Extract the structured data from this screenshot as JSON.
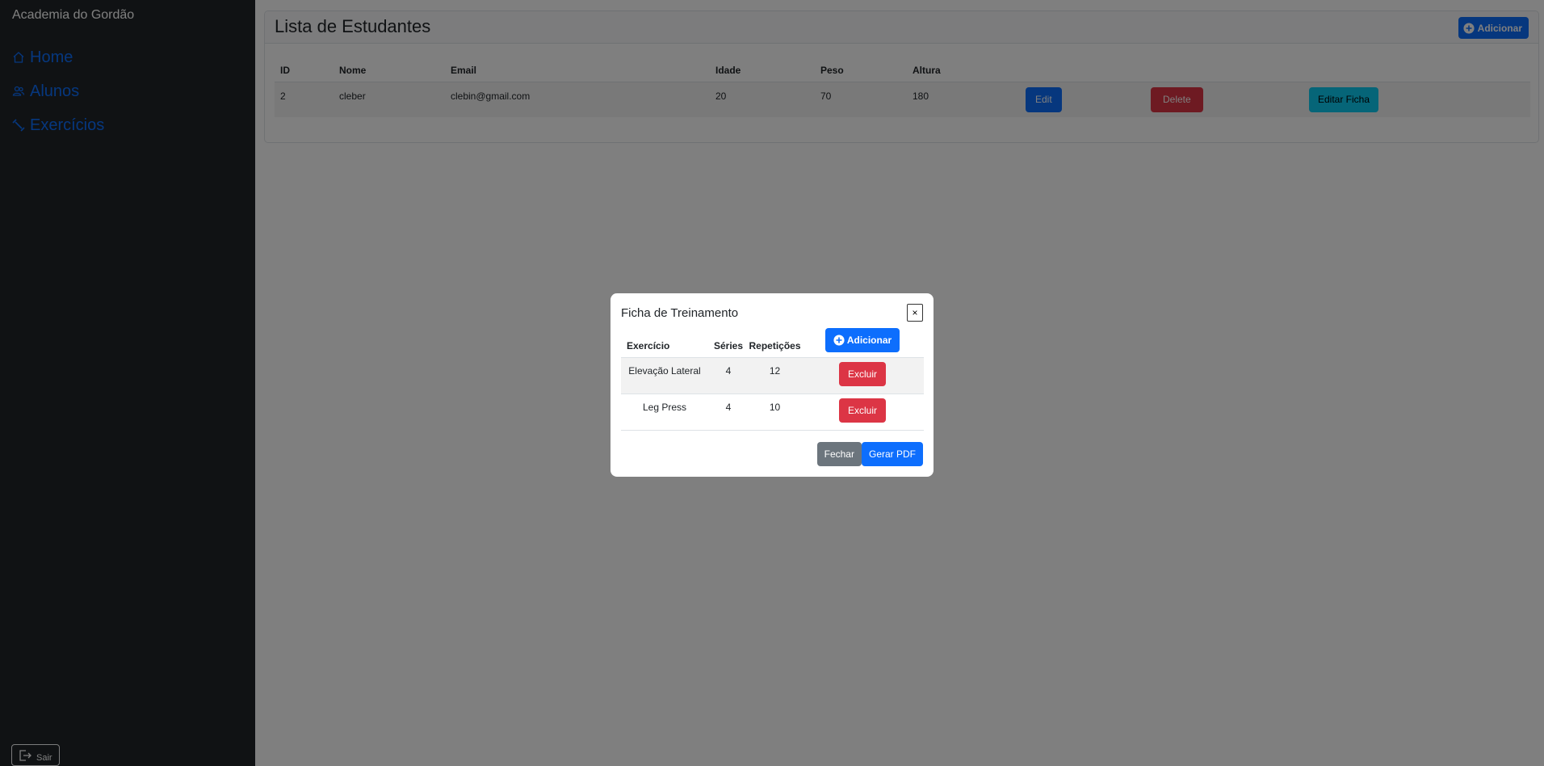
{
  "sidebar": {
    "brand": "Academia do Gordão",
    "items": [
      {
        "label": "Home",
        "icon": "home-icon"
      },
      {
        "label": "Alunos",
        "icon": "users-icon"
      },
      {
        "label": "Exercícios",
        "icon": "dumbbell-icon"
      }
    ],
    "logout_label": "Sair"
  },
  "main": {
    "title": "Lista de Estudantes",
    "add_label": "Adicionar",
    "columns": [
      "ID",
      "Nome",
      "Email",
      "Idade",
      "Peso",
      "Altura"
    ],
    "rows": [
      {
        "id": "2",
        "nome": "cleber",
        "email": "clebin@gmail.com",
        "idade": "20",
        "peso": "70",
        "altura": "180",
        "edit_label": "Edit",
        "delete_label": "Delete",
        "ficha_label": "Editar Ficha"
      }
    ]
  },
  "modal": {
    "title": "Ficha de Treinamento",
    "close_label": "×",
    "columns": [
      "Exercício",
      "Séries",
      "Repetições"
    ],
    "add_label": "Adicionar",
    "rows": [
      {
        "exercicio": "Elevação Lateral",
        "series": "4",
        "repeticoes": "12",
        "delete_label": "Excluir"
      },
      {
        "exercicio": "Leg Press",
        "series": "4",
        "repeticoes": "10",
        "delete_label": "Excluir"
      }
    ],
    "close_button_label": "Fechar",
    "pdf_button_label": "Gerar PDF"
  },
  "colors": {
    "sidebar_bg": "#212529",
    "primary": "#0d6efd",
    "danger": "#dc3545",
    "info": "#0dcaf0",
    "secondary": "#6c757d"
  }
}
